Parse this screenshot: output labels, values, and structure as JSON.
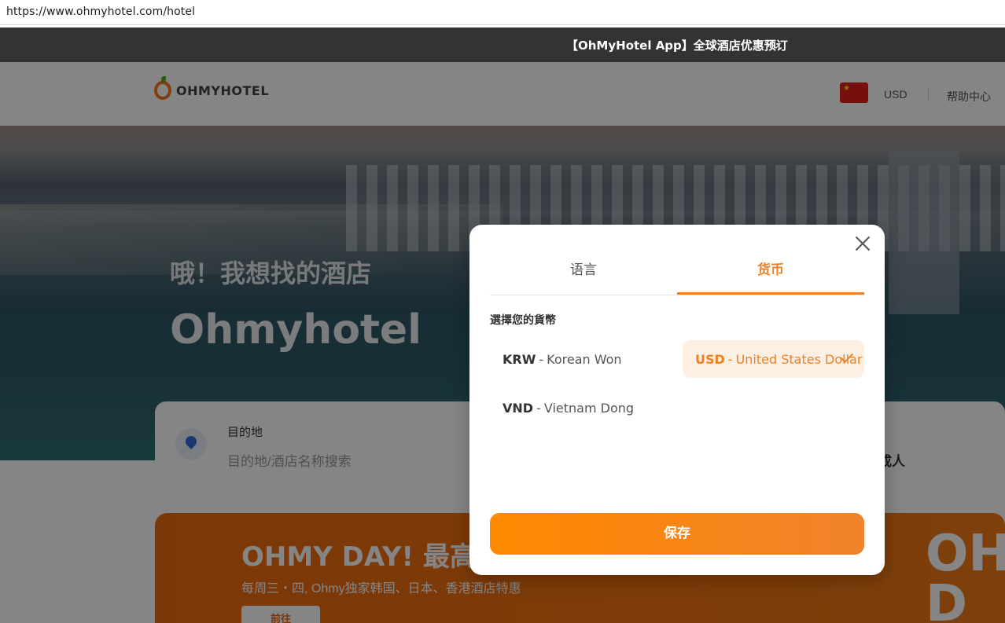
{
  "browser": {
    "url": "https://www.ohmyhotel.com/hotel"
  },
  "app_bar": {
    "promo_text": "【OhMyHotel App】全球酒店优惠预订",
    "expand_icon": "chevron-down-icon"
  },
  "header": {
    "logo_text": "OHMYHOTEL",
    "flag_icon": "china-flag-icon",
    "currency": "USD",
    "help_label": "帮助中心"
  },
  "hero": {
    "title_cn": "哦！我想找的酒店",
    "title_en": "Ohmyhotel"
  },
  "search": {
    "destination_label": "目的地",
    "destination_placeholder": "目的地/酒店名称搜索",
    "guests_value": "成人"
  },
  "banner": {
    "title": "OHMY DAY! 最高",
    "subtitle": "每周三・四, Ohmy独家韩国、日本、香港酒店特惠",
    "button_label": "前往",
    "big_text": "OHMY D"
  },
  "modal": {
    "tabs": [
      {
        "label": "语言",
        "active": false
      },
      {
        "label": "货币",
        "active": true
      }
    ],
    "section_title": "選擇您的貨幣",
    "currencies": [
      {
        "code": "KRW",
        "name": "Korean Won",
        "selected": false
      },
      {
        "code": "USD",
        "name": "United States Dollar",
        "selected": true
      },
      {
        "code": "VND",
        "name": "Vietnam Dong",
        "selected": false
      }
    ],
    "save_label": "保存",
    "close_icon": "close-icon",
    "check_icon": "check-icon"
  },
  "colors": {
    "accent": "#f08024",
    "app_bar_bg": "#333333",
    "selected_bg": "#fdf0e3",
    "overlay": "rgba(0,0,0,0.48)"
  }
}
